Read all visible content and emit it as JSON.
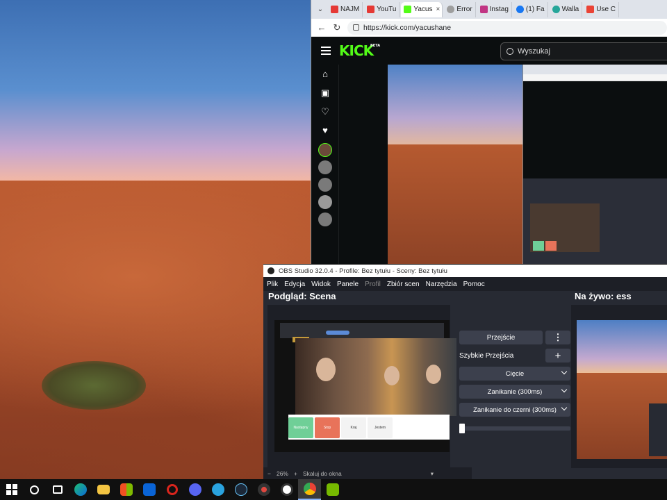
{
  "browser": {
    "tabs": [
      {
        "label": "NAJM",
        "favicon_color": "#e53935"
      },
      {
        "label": "YouTu",
        "favicon_color": "#e53935"
      },
      {
        "label": "Yacus",
        "favicon_color": "#53fc18",
        "active": true
      },
      {
        "label": "Error",
        "favicon_color": "#9e9e9e"
      },
      {
        "label": "Instag",
        "favicon_color": "#c13584"
      },
      {
        "label": "(1) Fa",
        "favicon_color": "#1877f2"
      },
      {
        "label": "Walla",
        "favicon_color": "#26a69a"
      },
      {
        "label": "Use C",
        "favicon_color": "#ea4335"
      }
    ],
    "url": "https://kick.com/yacushane"
  },
  "kick": {
    "logo": "KICK",
    "logo_badge": "BETA",
    "search_placeholder": "Wyszukaj",
    "brand_color": "#53fc18"
  },
  "obs": {
    "title": "OBS Studio 32.0.4 - Profile: Bez tytułu - Sceny: Bez tytułu",
    "menu": [
      "Plik",
      "Edycja",
      "Widok",
      "Panele",
      "Profil",
      "Zbiór scen",
      "Narzędzia",
      "Pomoc"
    ],
    "preview_title": "Podgląd: Scena",
    "live_title": "Na żywo: ess",
    "transition_button": "Przejście",
    "quick_transitions_label": "Szybkie Przejścia",
    "transition_options": [
      "Cięcie",
      "Zanikanie (300ms)",
      "Zanikanie do czerni (300ms)"
    ],
    "zoom_level": "26%",
    "zoom_fit": "Skaluj do okna",
    "preview_buttons": [
      "Następny",
      "Stop",
      "Kraj",
      "Jestem"
    ]
  },
  "taskbar": {
    "items": [
      "start",
      "search",
      "task-view",
      "edge",
      "file-explorer",
      "store",
      "mail",
      "opera",
      "discord",
      "telegram",
      "steam",
      "davinci",
      "obs",
      "chrome",
      "nvidia"
    ]
  }
}
